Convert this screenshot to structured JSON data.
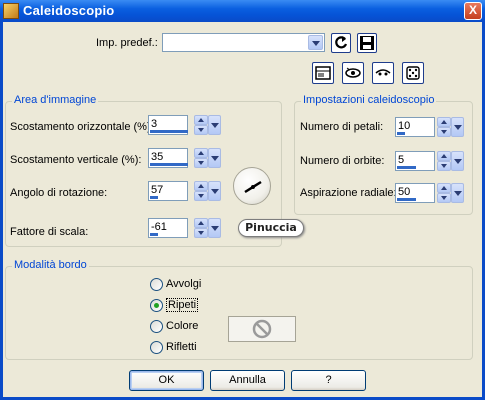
{
  "window": {
    "title": "Caleidoscopio",
    "close_glyph": "X"
  },
  "preset": {
    "label": "Imp. predef.:",
    "value": ""
  },
  "area": {
    "title": "Area d'immagine",
    "fields": [
      {
        "label": "Scostamento orizzontale (%):",
        "value": "3",
        "fill": 0.5
      },
      {
        "label": "Scostamento verticale (%):",
        "value": "35",
        "fill": 0.68
      },
      {
        "label": "Angolo di rotazione:",
        "value": "57",
        "fill": 0.2
      },
      {
        "label": "Fattore di scala:",
        "value": "-61",
        "fill": 0.2
      }
    ]
  },
  "settings": {
    "title": "Impostazioni caleidoscopio",
    "fields": [
      {
        "label": "Numero di petali:",
        "value": "10",
        "fill": 0.2
      },
      {
        "label": "Numero di orbite:",
        "value": "5",
        "fill": 0.5
      },
      {
        "label": "Aspirazione radiale:",
        "value": "50",
        "fill": 0.5
      }
    ]
  },
  "border": {
    "title": "Modalità bordo",
    "options": [
      {
        "label": "Avvolgi",
        "checked": false
      },
      {
        "label": "Ripeti",
        "checked": true
      },
      {
        "label": "Colore",
        "checked": false
      },
      {
        "label": "Rifletti",
        "checked": false
      }
    ]
  },
  "watermark": "Pinuccia",
  "buttons": {
    "ok": "OK",
    "cancel": "Annulla",
    "help": "?"
  },
  "icons": [
    "app-icon",
    "reset-icon",
    "save-preset-icon",
    "layout-icon",
    "eye-open-icon",
    "eye-closed-icon",
    "dice-icon",
    "no-symbol-icon"
  ],
  "colors": {
    "title_bar": "#0a5fe0",
    "group_label": "#0046d5",
    "slider_bar": "#3169c6",
    "radio_dot": "#21a121"
  }
}
